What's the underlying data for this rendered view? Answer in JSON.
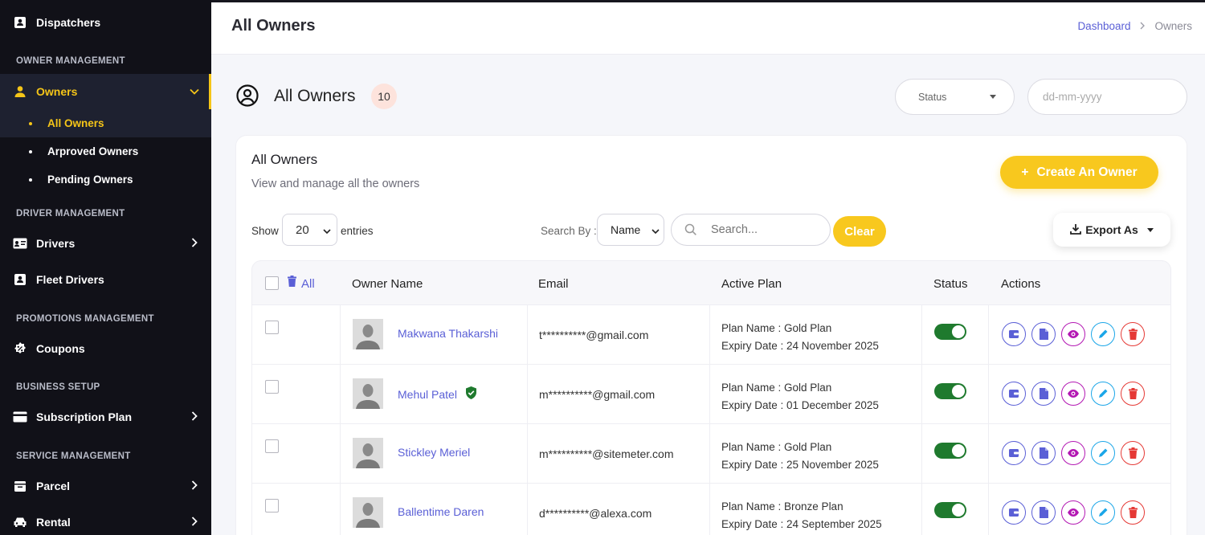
{
  "sidebar": {
    "dispatchers": "Dispatchers",
    "owner_management": "OWNER MANAGEMENT",
    "owners": "Owners",
    "all_owners": "All Owners",
    "approved_owners": "Arproved Owners",
    "pending_owners": "Pending Owners",
    "driver_management": "DRIVER MANAGEMENT",
    "drivers": "Drivers",
    "fleet_drivers": "Fleet Drivers",
    "promotions_management": "PROMOTIONS MANAGEMENT",
    "coupons": "Coupons",
    "business_setup": "BUSINESS SETUP",
    "subscription_plan": "Subscription Plan",
    "service_management": "SERVICE MANAGEMENT",
    "parcel": "Parcel",
    "rental": "Rental",
    "accent_color": "#f5c518"
  },
  "header": {
    "title": "All Owners",
    "breadcrumb_home": "Dashboard",
    "breadcrumb_current": "Owners"
  },
  "section": {
    "title": "All Owners",
    "count": "10",
    "status_placeholder": "Status",
    "date_placeholder": "dd-mm-yyyy"
  },
  "card": {
    "title": "All Owners",
    "subtitle": "View and manage all the owners",
    "create_label": "Create An Owner",
    "show_label": "Show",
    "entries_value": "20",
    "entries_label": "entries",
    "search_by_label": "Search By :",
    "search_by_value": "Name",
    "search_placeholder": "Search...",
    "clear_label": "Clear",
    "export_label": "Export As"
  },
  "table": {
    "headers": {
      "all": "All",
      "owner_name": "Owner Name",
      "email": "Email",
      "active_plan": "Active Plan",
      "status": "Status",
      "actions": "Actions"
    },
    "rows": [
      {
        "name": "Makwana Thakarshi",
        "verified": false,
        "email": "t**********@gmail.com",
        "plan": "Plan Name : Gold Plan",
        "expiry": "Expiry Date : 24 November 2025",
        "status": true
      },
      {
        "name": "Mehul Patel",
        "verified": true,
        "email": "m**********@gmail.com",
        "plan": "Plan Name : Gold Plan",
        "expiry": "Expiry Date : 01 December 2025",
        "status": true
      },
      {
        "name": "Stickley Meriel",
        "verified": false,
        "email": "m**********@sitemeter.com",
        "plan": "Plan Name : Gold Plan",
        "expiry": "Expiry Date : 25 November 2025",
        "status": true
      },
      {
        "name": "Ballentime Daren",
        "verified": false,
        "email": "d**********@alexa.com",
        "plan": "Plan Name : Bronze Plan",
        "expiry": "Expiry Date : 24 September 2025",
        "status": true
      }
    ]
  },
  "colors": {
    "primary_link": "#5a5fd6",
    "yellow": "#f8c81e",
    "toggle_on": "#1f7a2e"
  }
}
